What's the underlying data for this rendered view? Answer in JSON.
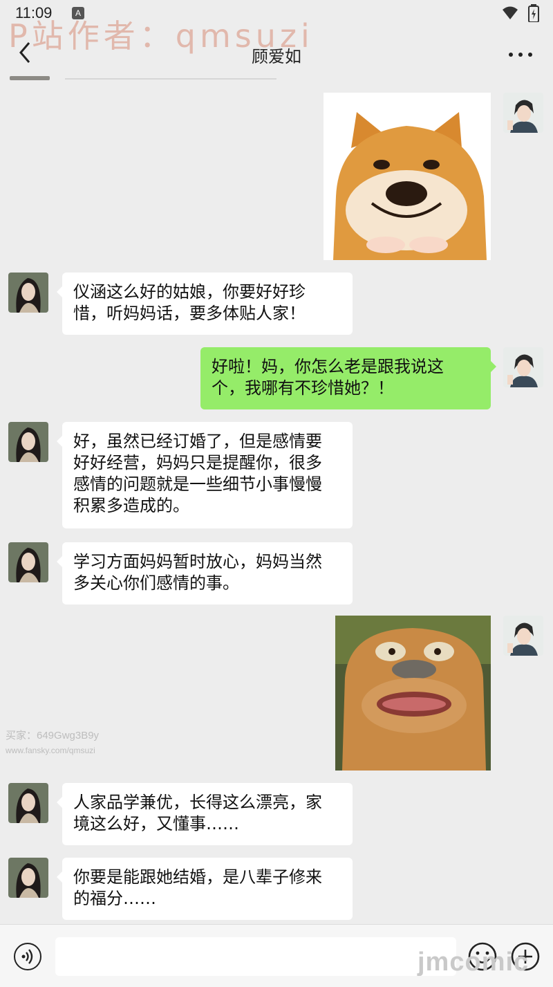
{
  "status_bar": {
    "time": "11:09",
    "indicator": "A"
  },
  "watermark": "P站作者：qmsuzi",
  "header": {
    "title": "顾爱如",
    "back_icon": "chevron-left-icon",
    "more_icon": "more-dots-icon"
  },
  "messages": [
    {
      "side": "right",
      "type": "sticker",
      "sticker": "shiba-dog-sticker"
    },
    {
      "side": "left",
      "type": "text",
      "text": "仪涵这么好的姑娘，你要好好珍\n惜，听妈妈话，要多体贴人家！"
    },
    {
      "side": "right",
      "type": "text",
      "text": "好啦！妈，你怎么老是跟我说这\n个，我哪有不珍惜她？！"
    },
    {
      "side": "left",
      "type": "text",
      "text": "好，虽然已经订婚了，但是感情要\n好好经营，妈妈只是提醒你，很多\n感情的问题就是一些细节小事慢慢\n积累多造成的。"
    },
    {
      "side": "left",
      "type": "text",
      "text": "学习方面妈妈暂时放心，妈妈当然\n多关心你们感情的事。"
    },
    {
      "side": "right",
      "type": "sticker",
      "sticker": "worried-bear-sticker"
    },
    {
      "side": "left",
      "type": "text",
      "text": "人家品学兼优，长得这么漂亮，家\n境这么好，又懂事……"
    },
    {
      "side": "left",
      "type": "text",
      "text": "你要是能跟她结婚，是八辈子修来\n的福分……"
    }
  ],
  "side_watermark": {
    "line1": "买家：649Gwg3B9y",
    "line2": "www.fansky.com/qmsuzi"
  },
  "input_bar": {
    "placeholder": "",
    "voice_icon": "voice-icon",
    "emoji_icon": "emoji-icon",
    "plus_icon": "plus-icon"
  },
  "corner_watermark": "jmcomic",
  "colors": {
    "background": "#ededed",
    "sent_bubble": "#95ec69",
    "received_bubble": "#ffffff"
  }
}
